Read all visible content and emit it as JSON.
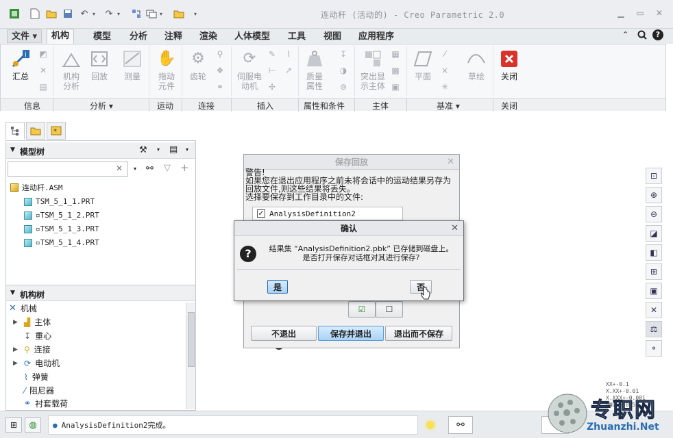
{
  "window": {
    "title": "连动杆 (活动的) - Creo Parametric 2.0",
    "minimize": "▭",
    "restore": "▭",
    "close": "✕"
  },
  "tabs": [
    {
      "label": "文件 ▾"
    },
    {
      "label": "机构"
    },
    {
      "label": "模型"
    },
    {
      "label": "分析"
    },
    {
      "label": "注释"
    },
    {
      "label": "渲染"
    },
    {
      "label": "人体模型"
    },
    {
      "label": "工具"
    },
    {
      "label": "视图"
    },
    {
      "label": "应用程序"
    }
  ],
  "ribbon": {
    "buttons": [
      {
        "label": "汇总"
      },
      {
        "label": "机构\n分析"
      },
      {
        "label": "回放"
      },
      {
        "label": "测量"
      },
      {
        "label": "拖动\n元件"
      },
      {
        "label": "齿轮"
      },
      {
        "label": "伺服电\n动机"
      },
      {
        "label": "质量\n属性"
      },
      {
        "label": "突出显\n示主体"
      },
      {
        "label": "平面"
      },
      {
        "label": "草绘"
      },
      {
        "label": "关闭"
      }
    ],
    "groups": [
      {
        "label": "信息"
      },
      {
        "label": "分析 ▾"
      },
      {
        "label": "运动"
      },
      {
        "label": "连接"
      },
      {
        "label": "插入"
      },
      {
        "label": "属性和条件"
      },
      {
        "label": "主体"
      },
      {
        "label": "基准 ▾"
      },
      {
        "label": "关闭"
      }
    ]
  },
  "model_tree": {
    "header": "模型树",
    "search_placeholder": "",
    "items": [
      {
        "label": "连动杆.ASM"
      },
      {
        "label": "TSM_5_1_1.PRT"
      },
      {
        "label": "▫TSM_5_1_2.PRT"
      },
      {
        "label": "▫TSM_5_1_3.PRT"
      },
      {
        "label": "▫TSM_5_1_4.PRT"
      }
    ]
  },
  "mech_tree": {
    "header": "机构树",
    "items": [
      {
        "label": "机械"
      },
      {
        "label": "主体"
      },
      {
        "label": "重心"
      },
      {
        "label": "连接"
      },
      {
        "label": "电动机"
      },
      {
        "label": "弹簧"
      },
      {
        "label": "阻尼器"
      },
      {
        "label": "衬套载荷"
      }
    ]
  },
  "save_playback_dialog": {
    "title": "保存回放",
    "warning": "警告!",
    "message_line1": "如果您在退出应用程序之前未将会话中的运动结果另存为",
    "message_line2": "回放文件,则这些结果将丢失。",
    "message_line3": "选择要保存到工作目录中的文件:",
    "file_item": "AnalysisDefinition2",
    "btn_exit": "不退出",
    "btn_save_exit": "保存并退出",
    "btn_exit_nosave": "退出而不保存"
  },
  "confirm_dialog": {
    "title": "确认",
    "line1": "结果集 “AnalysisDefinition2.pbk” 已存储到磁盘上。",
    "line2": "是否打开保存对话框对其进行保存?",
    "yes": "是",
    "no": "否"
  },
  "status": {
    "message": "AnalysisDefinition2完成。"
  },
  "graphics_text": {
    "l1": "XX+-0.1",
    "l2": "X.XX+-0.01",
    "l3": "X.XXX+-0.001",
    "l4": "ANG.+-0.5"
  },
  "watermark": {
    "cn": "专职网",
    "url": "Zhuanzhi.Net"
  },
  "colors": {
    "accent": "#2a6db4",
    "close_red": "#d9322b"
  }
}
